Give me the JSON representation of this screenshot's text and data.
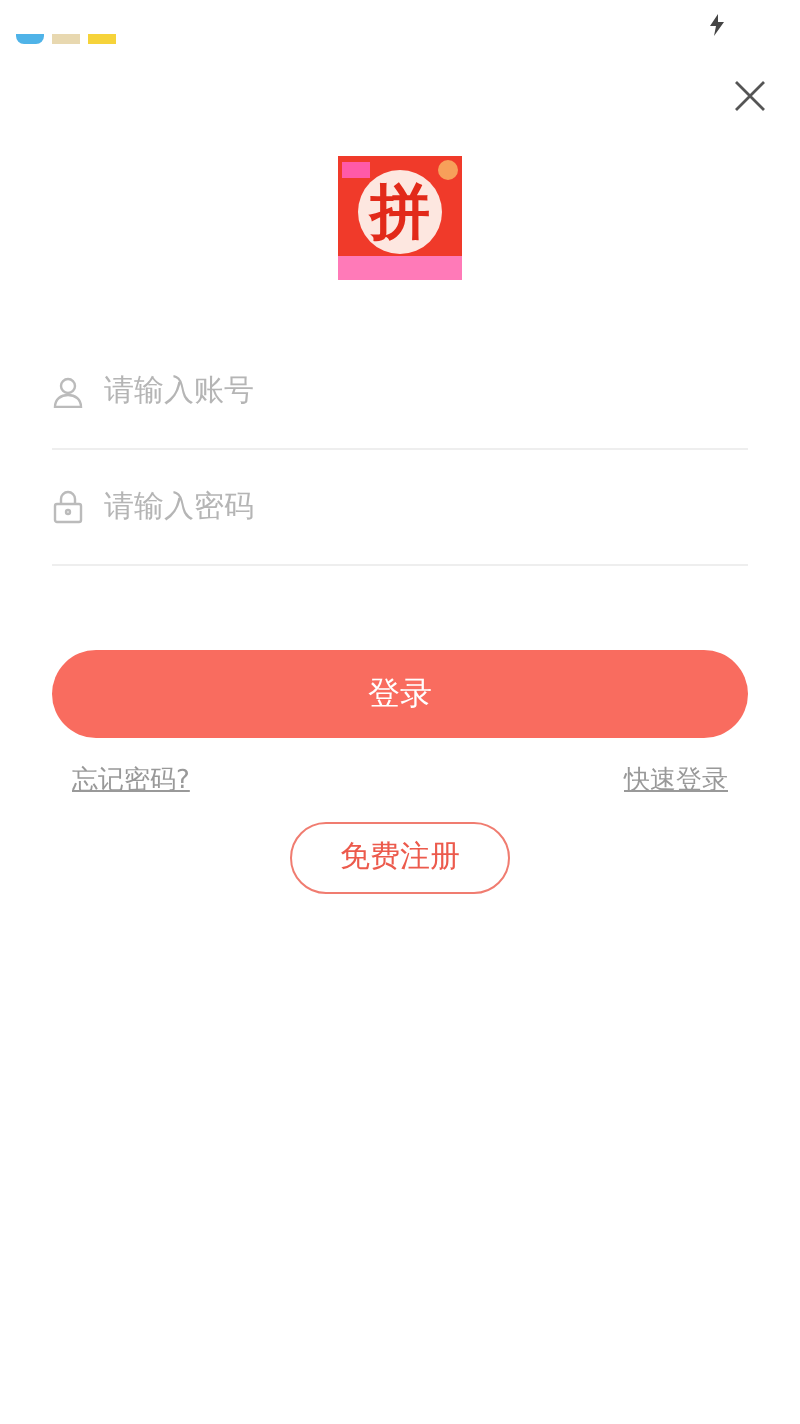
{
  "logo": {
    "glyph": "拼"
  },
  "fields": [
    {
      "kind": "account",
      "placeholder": "请输入账号"
    },
    {
      "kind": "password",
      "placeholder": "请输入密码"
    }
  ],
  "login_button": "登录",
  "links": [
    "忘记密码?",
    "快速登录"
  ],
  "register_button": "免费注册"
}
